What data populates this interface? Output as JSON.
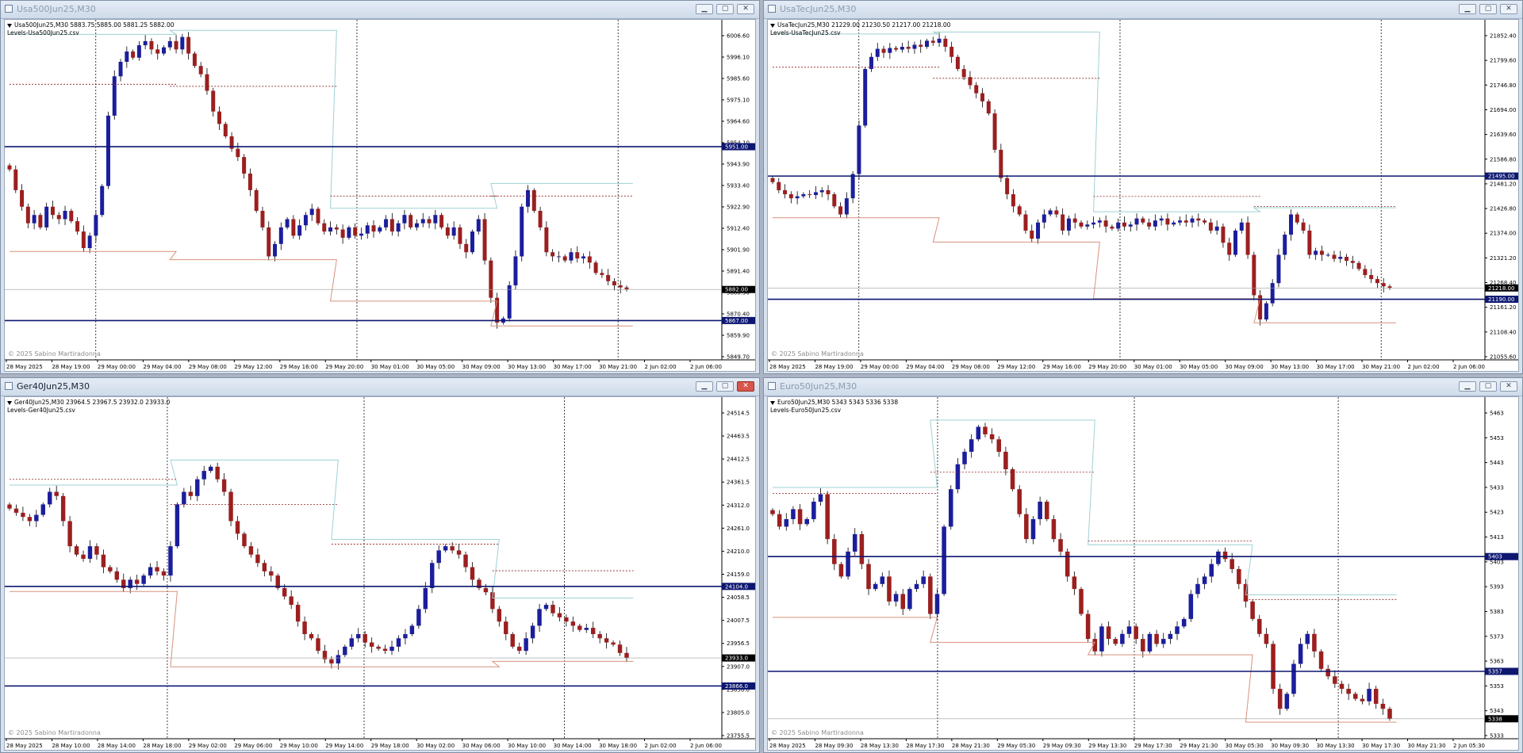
{
  "copyright": "© 2025 Sabino Martiradonna",
  "colors": {
    "bull": "#1b1e9c",
    "bear": "#9b1f1f",
    "level": "#0d1770",
    "orange": "#d8927d",
    "teal": "#9fd1d3",
    "dotted": "#8a1d1d",
    "sep": "#111111"
  },
  "windows": [
    {
      "name": "usa500",
      "window_title": "Usa500Jun25,M30",
      "active": false,
      "header": "Usa500Jun25,M30  5883.75 5885.00 5881.25 5882.00",
      "levels_file": "Levels-Usa500Jun25.csv",
      "price_labels": [
        "6006.60",
        "5996.10",
        "5985.60",
        "5975.10",
        "5964.60",
        "5954.10",
        "5943.90",
        "5933.40",
        "5922.90",
        "5912.40",
        "5901.90",
        "5891.40",
        "5880.90",
        "5870.40",
        "5859.90",
        "5849.70"
      ],
      "price_max": 6010,
      "price_min": 5848,
      "time_labels": [
        "28 May 2025",
        "28 May 19:00",
        "29 May 00:00",
        "29 May 04:00",
        "29 May 08:00",
        "29 May 12:00",
        "29 May 16:00",
        "29 May 20:00",
        "30 May 01:00",
        "30 May 05:00",
        "30 May 09:00",
        "30 May 13:00",
        "30 May 17:00",
        "30 May 21:00",
        "2 Jun 02:00",
        "2 Jun 06:00"
      ],
      "tags": [
        {
          "value": "5951.00",
          "price": 5951,
          "color": "#0d1770",
          "line": true
        },
        {
          "value": "5882.00",
          "price": 5882,
          "color": "#000000",
          "line": false
        },
        {
          "value": "5867.00",
          "price": 5867,
          "color": "#0d1770",
          "line": true
        }
      ],
      "seps": [
        0.125,
        0.49,
        0.855
      ],
      "closes": [
        5940,
        5930,
        5922,
        5914,
        5918,
        5912,
        5922,
        5918,
        5916,
        5920,
        5915,
        5910,
        5902,
        5908,
        5918,
        5932,
        5966,
        5985,
        5992,
        5997,
        5994,
        6000,
        6002,
        5998,
        5996,
        5999,
        6002,
        5998,
        6004,
        5996,
        5990,
        5986,
        5978,
        5968,
        5962,
        5956,
        5950,
        5946,
        5938,
        5930,
        5920,
        5912,
        5898,
        5904,
        5912,
        5916,
        5908,
        5913,
        5918,
        5921,
        5914,
        5910,
        5912,
        5911,
        5907,
        5912,
        5908,
        5909,
        5913,
        5910,
        5912,
        5916,
        5910,
        5914,
        5918,
        5912,
        5914,
        5916,
        5914,
        5918,
        5912,
        5908,
        5912,
        5904,
        5900,
        5910,
        5916,
        5896,
        5878,
        5866,
        5868,
        5884,
        5898,
        5922,
        5930,
        5920,
        5912,
        5900,
        5898,
        5898,
        5896,
        5900,
        5897,
        5898,
        5895,
        5890,
        5889,
        5886,
        5884,
        5883,
        5882
      ]
    },
    {
      "name": "usatec",
      "window_title": "UsaTecJun25,M30",
      "active": false,
      "header": "UsaTecJun25,M30  21229.00 21230.50 21217.00 21218.00",
      "levels_file": "Levels-UsaTecJun25.csv",
      "price_labels": [
        "21852.40",
        "21799.60",
        "21746.80",
        "21694.00",
        "21639.60",
        "21586.80",
        "21481.20",
        "21426.80",
        "21374.00",
        "21321.20",
        "21268.40",
        "21161.20",
        "21108.40",
        "21055.60"
      ],
      "price_max": 21870,
      "price_min": 21040,
      "time_labels": [
        "28 May 2025",
        "28 May 19:00",
        "29 May 00:00",
        "29 May 04:00",
        "29 May 08:00",
        "29 May 12:00",
        "29 May 16:00",
        "29 May 20:00",
        "30 May 01:00",
        "30 May 05:00",
        "30 May 09:00",
        "30 May 13:00",
        "30 May 17:00",
        "30 May 21:00",
        "2 Jun 02:00",
        "2 Jun 06:00"
      ],
      "tags": [
        {
          "value": "21495.00",
          "price": 21495,
          "color": "#0d1770",
          "line": true
        },
        {
          "value": "21218.00",
          "price": 21218,
          "color": "#000000",
          "line": false
        },
        {
          "value": "21190.00",
          "price": 21190,
          "color": "#0d1770",
          "line": true
        }
      ],
      "seps": [
        0.125,
        0.49,
        0.855
      ],
      "closes": [
        21480,
        21460,
        21450,
        21440,
        21445,
        21450,
        21448,
        21455,
        21460,
        21450,
        21420,
        21400,
        21440,
        21500,
        21620,
        21760,
        21790,
        21810,
        21800,
        21812,
        21808,
        21815,
        21810,
        21820,
        21815,
        21830,
        21825,
        21835,
        21815,
        21790,
        21760,
        21740,
        21720,
        21700,
        21680,
        21650,
        21560,
        21490,
        21450,
        21420,
        21400,
        21360,
        21340,
        21380,
        21400,
        21410,
        21400,
        21360,
        21390,
        21380,
        21370,
        21375,
        21380,
        21385,
        21370,
        21365,
        21380,
        21370,
        21375,
        21390,
        21380,
        21370,
        21385,
        21390,
        21375,
        21380,
        21385,
        21380,
        21390,
        21385,
        21380,
        21360,
        21370,
        21330,
        21300,
        21360,
        21380,
        21300,
        21200,
        21140,
        21180,
        21230,
        21300,
        21350,
        21400,
        21380,
        21360,
        21300,
        21310,
        21300,
        21300,
        21290,
        21295,
        21285,
        21280,
        21265,
        21250,
        21240,
        21230,
        21222,
        21218
      ]
    },
    {
      "name": "ger40",
      "window_title": "Ger40Jun25,M30",
      "active": true,
      "header": "Ger40Jun25,M30  23964.5 23967.5 23932.0 23933.0",
      "levels_file": "Levels-Ger40Jun25.csv",
      "price_labels": [
        "24514.5",
        "24463.5",
        "24412.5",
        "24361.5",
        "24312.0",
        "24261.0",
        "24210.0",
        "24159.0",
        "24058.5",
        "24007.5",
        "23956.5",
        "23907.0",
        "23856.0",
        "23805.0",
        "23755.5"
      ],
      "price_max": 24545,
      "price_min": 23740,
      "time_labels": [
        "28 May 2025",
        "28 May 10:00",
        "28 May 14:00",
        "28 May 18:00",
        "29 May 02:00",
        "29 May 06:00",
        "29 May 10:00",
        "29 May 14:00",
        "29 May 18:00",
        "30 May 02:00",
        "30 May 06:00",
        "30 May 10:00",
        "30 May 14:00",
        "30 May 18:00",
        "2 Jun 02:00",
        "2 Jun 06:00"
      ],
      "tags": [
        {
          "value": "24104.0",
          "price": 24104,
          "color": "#0d1770",
          "line": true
        },
        {
          "value": "23933.0",
          "price": 23933,
          "color": "#000000",
          "line": false
        },
        {
          "value": "23866.0",
          "price": 23866,
          "color": "#0d1770",
          "line": true
        }
      ],
      "seps": [
        0.225,
        0.5,
        0.78
      ],
      "closes": [
        24290,
        24280,
        24270,
        24260,
        24275,
        24300,
        24330,
        24320,
        24260,
        24200,
        24180,
        24170,
        24200,
        24180,
        24150,
        24140,
        24120,
        24100,
        24120,
        24110,
        24130,
        24150,
        24140,
        24130,
        24200,
        24300,
        24330,
        24320,
        24360,
        24380,
        24390,
        24360,
        24330,
        24260,
        24230,
        24200,
        24180,
        24160,
        24140,
        24130,
        24100,
        24080,
        24060,
        24020,
        23990,
        23980,
        23950,
        23930,
        23920,
        23940,
        23960,
        23980,
        23990,
        23970,
        23960,
        23955,
        23950,
        23960,
        23980,
        23990,
        24010,
        24050,
        24100,
        24160,
        24190,
        24200,
        24190,
        24180,
        24150,
        24120,
        24100,
        24090,
        24050,
        24020,
        23990,
        23960,
        23950,
        23980,
        24010,
        24050,
        24060,
        24040,
        24030,
        24020,
        24010,
        24000,
        24005,
        23990,
        23980,
        23970,
        23965,
        23945,
        23933
      ]
    },
    {
      "name": "euro50",
      "window_title": "Euro50Jun25,M30",
      "active": false,
      "header": "Euro50Jun25,M30  5343 5343 5336 5338",
      "levels_file": "Levels-Euro50Jun25.csv",
      "price_labels": [
        "5463",
        "5453",
        "5443",
        "5433",
        "5423",
        "5413",
        "5403",
        "5393",
        "5383",
        "5373",
        "5363",
        "5353",
        "5343",
        "5333"
      ],
      "price_max": 5465,
      "price_min": 5330,
      "time_labels": [
        "28 May 2025",
        "28 May 09:30",
        "28 May 13:30",
        "28 May 17:30",
        "28 May 21:30",
        "29 May 05:30",
        "29 May 09:30",
        "29 May 13:30",
        "29 May 17:30",
        "29 May 21:30",
        "30 May 05:30",
        "30 May 09:30",
        "30 May 13:30",
        "30 May 17:30",
        "30 May 21:30",
        "2 Jun 05:30"
      ],
      "tags": [
        {
          "value": "5403",
          "price": 5403,
          "color": "#0d1770",
          "line": true
        },
        {
          "value": "5357",
          "price": 5357,
          "color": "#0d1770",
          "line": true
        },
        {
          "value": "5338",
          "price": 5338,
          "color": "#000000",
          "line": false
        }
      ],
      "seps": [
        0.235,
        0.51,
        0.795
      ],
      "closes": [
        5420,
        5415,
        5418,
        5422,
        5416,
        5418,
        5425,
        5428,
        5410,
        5400,
        5395,
        5405,
        5412,
        5400,
        5390,
        5392,
        5395,
        5385,
        5388,
        5382,
        5390,
        5392,
        5395,
        5380,
        5388,
        5415,
        5430,
        5440,
        5445,
        5450,
        5455,
        5452,
        5450,
        5445,
        5438,
        5430,
        5420,
        5410,
        5418,
        5425,
        5418,
        5410,
        5405,
        5395,
        5390,
        5380,
        5370,
        5365,
        5375,
        5370,
        5368,
        5372,
        5375,
        5370,
        5365,
        5372,
        5368,
        5370,
        5372,
        5375,
        5378,
        5388,
        5392,
        5395,
        5400,
        5405,
        5402,
        5398,
        5392,
        5385,
        5378,
        5372,
        5368,
        5350,
        5342,
        5348,
        5360,
        5368,
        5372,
        5365,
        5358,
        5355,
        5352,
        5350,
        5348,
        5346,
        5345,
        5350,
        5344,
        5342,
        5338
      ]
    }
  ]
}
